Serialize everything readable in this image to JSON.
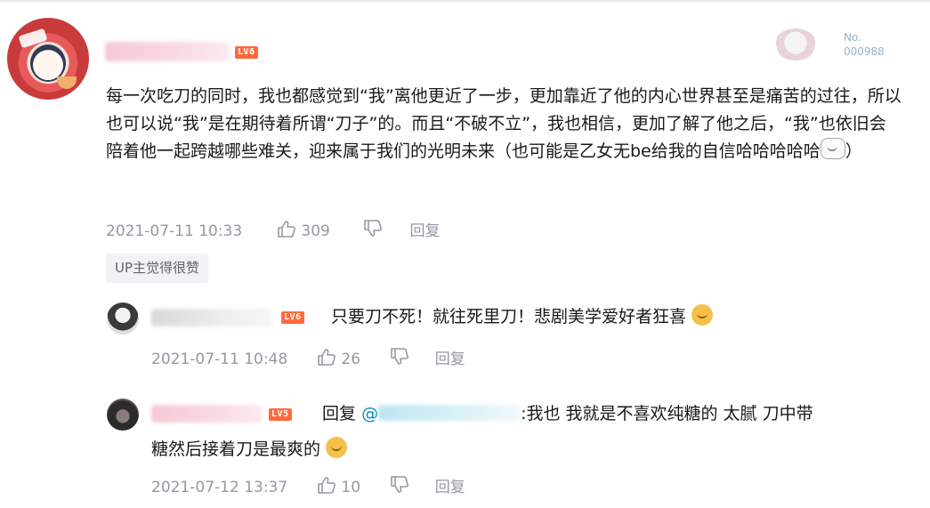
{
  "main_comment": {
    "level_badge": "LV6",
    "fan_badge": {
      "label": "No.",
      "number": "000988"
    },
    "text": "每一次吃刀的同时，我也都感觉到“我”离他更近了一步，更加靠近了他的内心世界甚至是痛苦的过往，所以也可以说“我”是在期待着所谓“刀子”的。而且“不破不立”，我也相信，更加了解了他之后，“我”也依旧会陪着他一起跨越哪些难关，迎来属于我们的光明未来（也可能是乙女无be给我的自信哈哈哈哈哈",
    "text_tail": "）",
    "timestamp": "2021-07-11 10:33",
    "like_count": "309",
    "reply_label": "回复",
    "up_tag": "UP主觉得很赞"
  },
  "replies": [
    {
      "level_badge": "LV6",
      "text": "只要刀不死！就往死里刀！悲剧美学爱好者狂喜",
      "timestamp": "2021-07-11 10:48",
      "like_count": "26",
      "reply_label": "回复"
    },
    {
      "level_badge": "LV5",
      "reply_prefix": "回复",
      "mention_at": "@",
      "text_line1": ":我也 我就是不喜欢纯糖的 太腻 刀中带",
      "text_line2": "糖然后接着刀是最爽的",
      "timestamp": "2021-07-12 13:37",
      "like_count": "10",
      "reply_label": "回复"
    }
  ],
  "colors": {
    "level6": "#ff6a3d",
    "level5": "#ff6a3d",
    "meta": "#9499a0",
    "mention": "#008ac5"
  },
  "icons": [
    "thumbs-up-icon",
    "thumbs-down-icon",
    "doge-emoji-icon",
    "kaomoji-icon"
  ]
}
